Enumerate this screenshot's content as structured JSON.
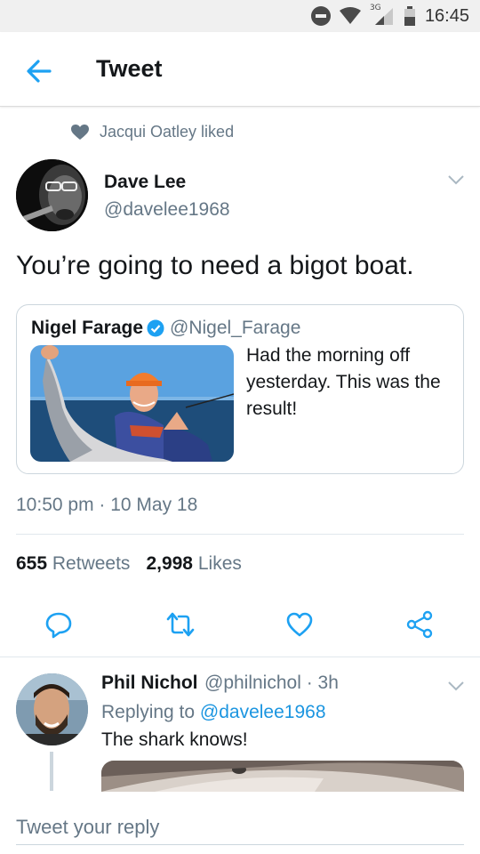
{
  "status_bar": {
    "time": "16:45",
    "network_label": "3G"
  },
  "app_bar": {
    "title": "Tweet",
    "back_icon": "arrow-left-icon"
  },
  "social_context": {
    "text": "Jacqui Oatley liked",
    "icon": "heart-icon"
  },
  "tweet": {
    "author_name": "Dave Lee",
    "author_handle": "@davelee1968",
    "text": "You’re going to need a bigot boat.",
    "timestamp": "10:50 pm · 10 May 18",
    "retweets_count": "655",
    "retweets_label": "Retweets",
    "likes_count": "2,998",
    "likes_label": "Likes"
  },
  "quoted_tweet": {
    "author_name": "Nigel Farage",
    "author_handle": "@Nigel_Farage",
    "text": "Had the morning off yesterday. This was the result!",
    "verified": true
  },
  "actions": [
    {
      "name": "reply",
      "icon": "reply-bubble-icon"
    },
    {
      "name": "retweet",
      "icon": "retweet-icon"
    },
    {
      "name": "like",
      "icon": "heart-outline-icon"
    },
    {
      "name": "share",
      "icon": "share-icon"
    }
  ],
  "reply": {
    "author_name": "Phil Nichol",
    "author_handle": "@philnichol · 3h",
    "replying_to_label": "Replying to",
    "replying_to_handle": "@davelee1968",
    "text": "The shark knows!"
  },
  "composer": {
    "placeholder": "Tweet your reply"
  },
  "colors": {
    "accent": "#1da1f2",
    "link": "#1b95e0",
    "secondary_text": "#657786",
    "primary_text": "#14171a"
  }
}
